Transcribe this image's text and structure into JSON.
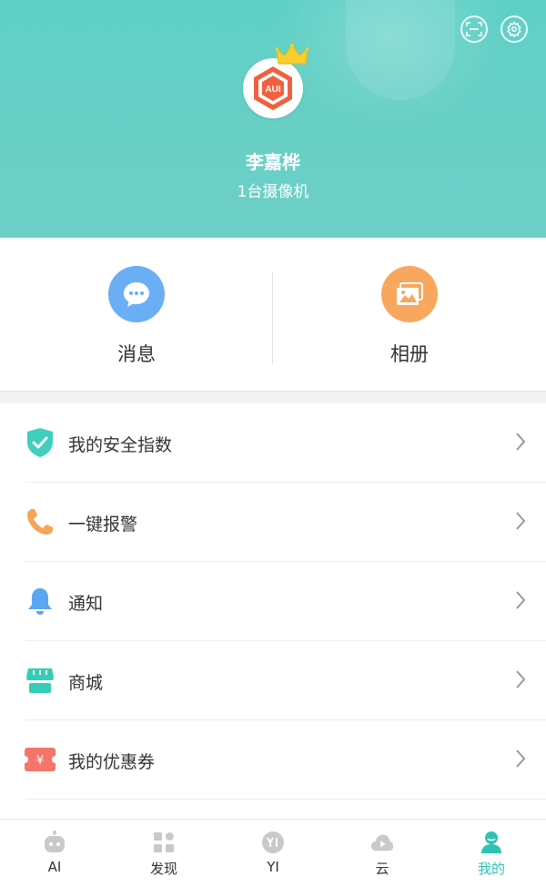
{
  "header": {
    "username": "李嘉桦",
    "subtitle": "1台摄像机",
    "avatar_text": "AUI"
  },
  "top_icons": [
    "scan-icon",
    "settings-gear-icon"
  ],
  "quick_actions": [
    {
      "label": "消息",
      "icon": "message-bubble-icon",
      "color": "#6aaef6"
    },
    {
      "label": "相册",
      "icon": "photo-album-icon",
      "color": "#f8a85e"
    }
  ],
  "menu": [
    {
      "label": "我的安全指数",
      "icon": "shield-check-icon",
      "color": "#3ecfbd"
    },
    {
      "label": "一键报警",
      "icon": "phone-icon",
      "color": "#f6a456"
    },
    {
      "label": "通知",
      "icon": "bell-icon",
      "color": "#5aa6f3"
    },
    {
      "label": "商城",
      "icon": "shop-icon",
      "color": "#34cdb7"
    },
    {
      "label": "我的优惠券",
      "icon": "coupon-icon",
      "color": "#f4766a",
      "badge": "¥"
    }
  ],
  "tabs": [
    {
      "label": "AI",
      "icon": "robot-icon",
      "active": false
    },
    {
      "label": "发现",
      "icon": "grid-icon",
      "active": false
    },
    {
      "label": "YI",
      "icon": "yi-logo-icon",
      "active": false
    },
    {
      "label": "云",
      "icon": "cloud-play-icon",
      "active": false
    },
    {
      "label": "我的",
      "icon": "user-icon",
      "active": true
    }
  ],
  "colors": {
    "accent": "#2ec2b3",
    "header": "#64cfc5",
    "inactive_icon": "#c9c9c9"
  }
}
